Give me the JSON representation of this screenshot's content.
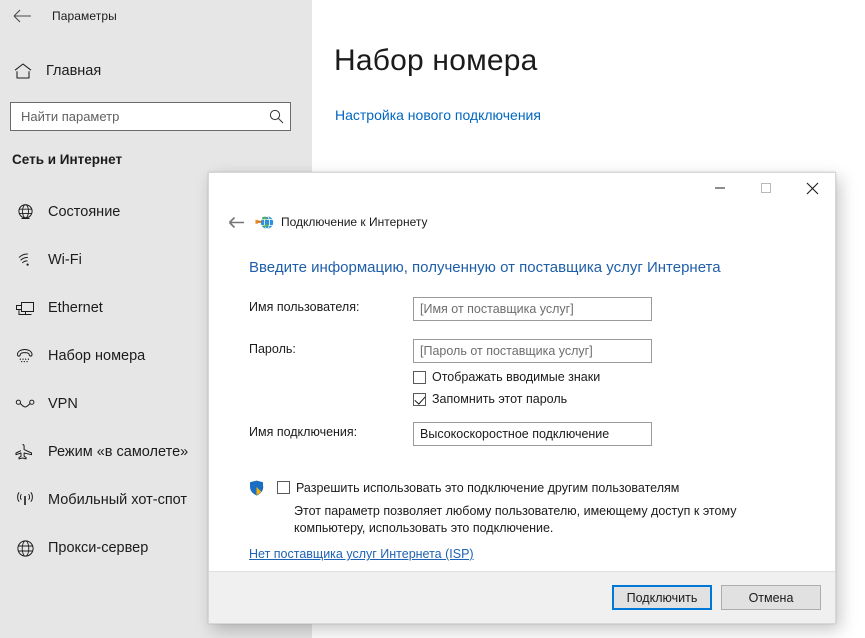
{
  "settings": {
    "titlebar": {
      "back_icon": "back-arrow-icon",
      "title": "Параметры"
    },
    "home": {
      "icon": "home-icon",
      "label": "Главная"
    },
    "search": {
      "placeholder": "Найти параметр",
      "value": "",
      "icon": "search-icon"
    },
    "section_header": "Сеть и Интернет",
    "nav_items": [
      {
        "label": "Состояние",
        "icon": "globe-status-icon"
      },
      {
        "label": "Wi-Fi",
        "icon": "wifi-icon"
      },
      {
        "label": "Ethernet",
        "icon": "ethernet-icon"
      },
      {
        "label": "Набор номера",
        "icon": "dialup-phone-icon"
      },
      {
        "label": "VPN",
        "icon": "vpn-icon"
      },
      {
        "label": "Режим «в самолете»",
        "icon": "airplane-icon"
      },
      {
        "label": "Мобильный хот-спот",
        "icon": "hotspot-icon"
      },
      {
        "label": "Прокси-сервер",
        "icon": "proxy-globe-icon"
      }
    ],
    "main": {
      "page_title": "Набор номера",
      "setup_link": "Настройка нового подключения"
    }
  },
  "dialog": {
    "window_controls": {
      "minimize": "minimize-icon",
      "maximize": "maximize-icon",
      "close": "close-icon"
    },
    "nav": {
      "back_icon": "back-arrow-icon",
      "app_icon": "internet-connection-globe-icon",
      "title": "Подключение к Интернету"
    },
    "heading": "Введите информацию, полученную от поставщика услуг Интернета",
    "fields": [
      {
        "label": "Имя пользователя:",
        "placeholder": "[Имя от поставщика услуг]",
        "value": ""
      },
      {
        "label": "Пароль:",
        "placeholder": "[Пароль от поставщика услуг]",
        "value": ""
      },
      {
        "label": "Имя подключения:",
        "placeholder": "",
        "value": "Высокоскоростное подключение"
      }
    ],
    "checkboxes": {
      "show_chars": {
        "label": "Отображать вводимые знаки",
        "checked": false
      },
      "remember_password": {
        "label": "Запомнить этот пароль",
        "checked": true
      }
    },
    "permission": {
      "shield_icon": "uac-shield-icon",
      "label": "Разрешить использовать это подключение другим пользователям",
      "checked": false,
      "description": "Этот параметр позволяет любому пользователю, имеющему доступ к этому компьютеру, использовать это подключение."
    },
    "isp_link": "Нет поставщика услуг Интернета (ISP)",
    "buttons": {
      "connect": "Подключить",
      "cancel": "Отмена"
    }
  },
  "colors": {
    "accent_blue": "#0067c0",
    "heading_blue": "#1f5fa9",
    "primary_border": "#0078d7",
    "sidebar_bg": "#e6e6e6",
    "footer_bg": "#f0f0f0"
  }
}
